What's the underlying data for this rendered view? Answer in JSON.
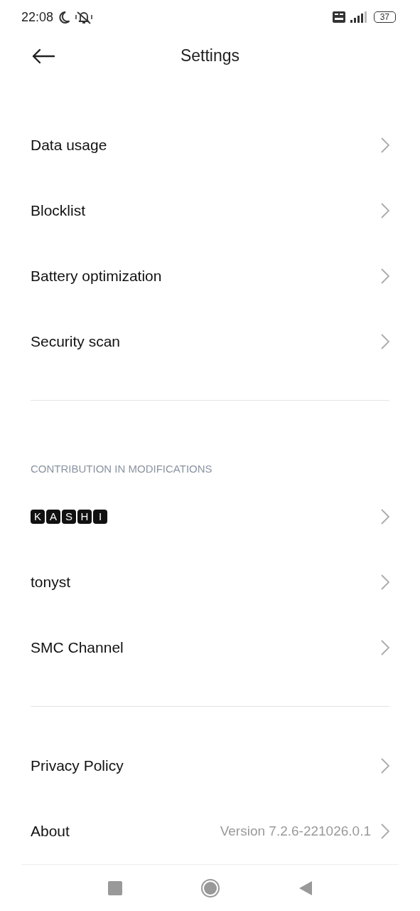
{
  "status_bar": {
    "time": "22:08",
    "battery": "37"
  },
  "header": {
    "title": "Settings"
  },
  "sections": [
    {
      "items": [
        {
          "label": "Data usage",
          "kind": "text"
        },
        {
          "label": "Blocklist",
          "kind": "text"
        },
        {
          "label": "Battery optimization",
          "kind": "text"
        },
        {
          "label": "Security scan",
          "kind": "text"
        }
      ]
    },
    {
      "heading": "CONTRIBUTION IN MODIFICATIONS",
      "items": [
        {
          "keys": [
            "K",
            "A",
            "S",
            "H",
            "I"
          ],
          "kind": "keycaps"
        },
        {
          "label": "tonyst",
          "kind": "text"
        },
        {
          "label": "SMC Channel",
          "kind": "text"
        }
      ]
    },
    {
      "items": [
        {
          "label": "Privacy Policy",
          "kind": "text"
        },
        {
          "label": "About",
          "kind": "text",
          "value": "Version 7.2.6-221026.0.1"
        }
      ]
    }
  ]
}
